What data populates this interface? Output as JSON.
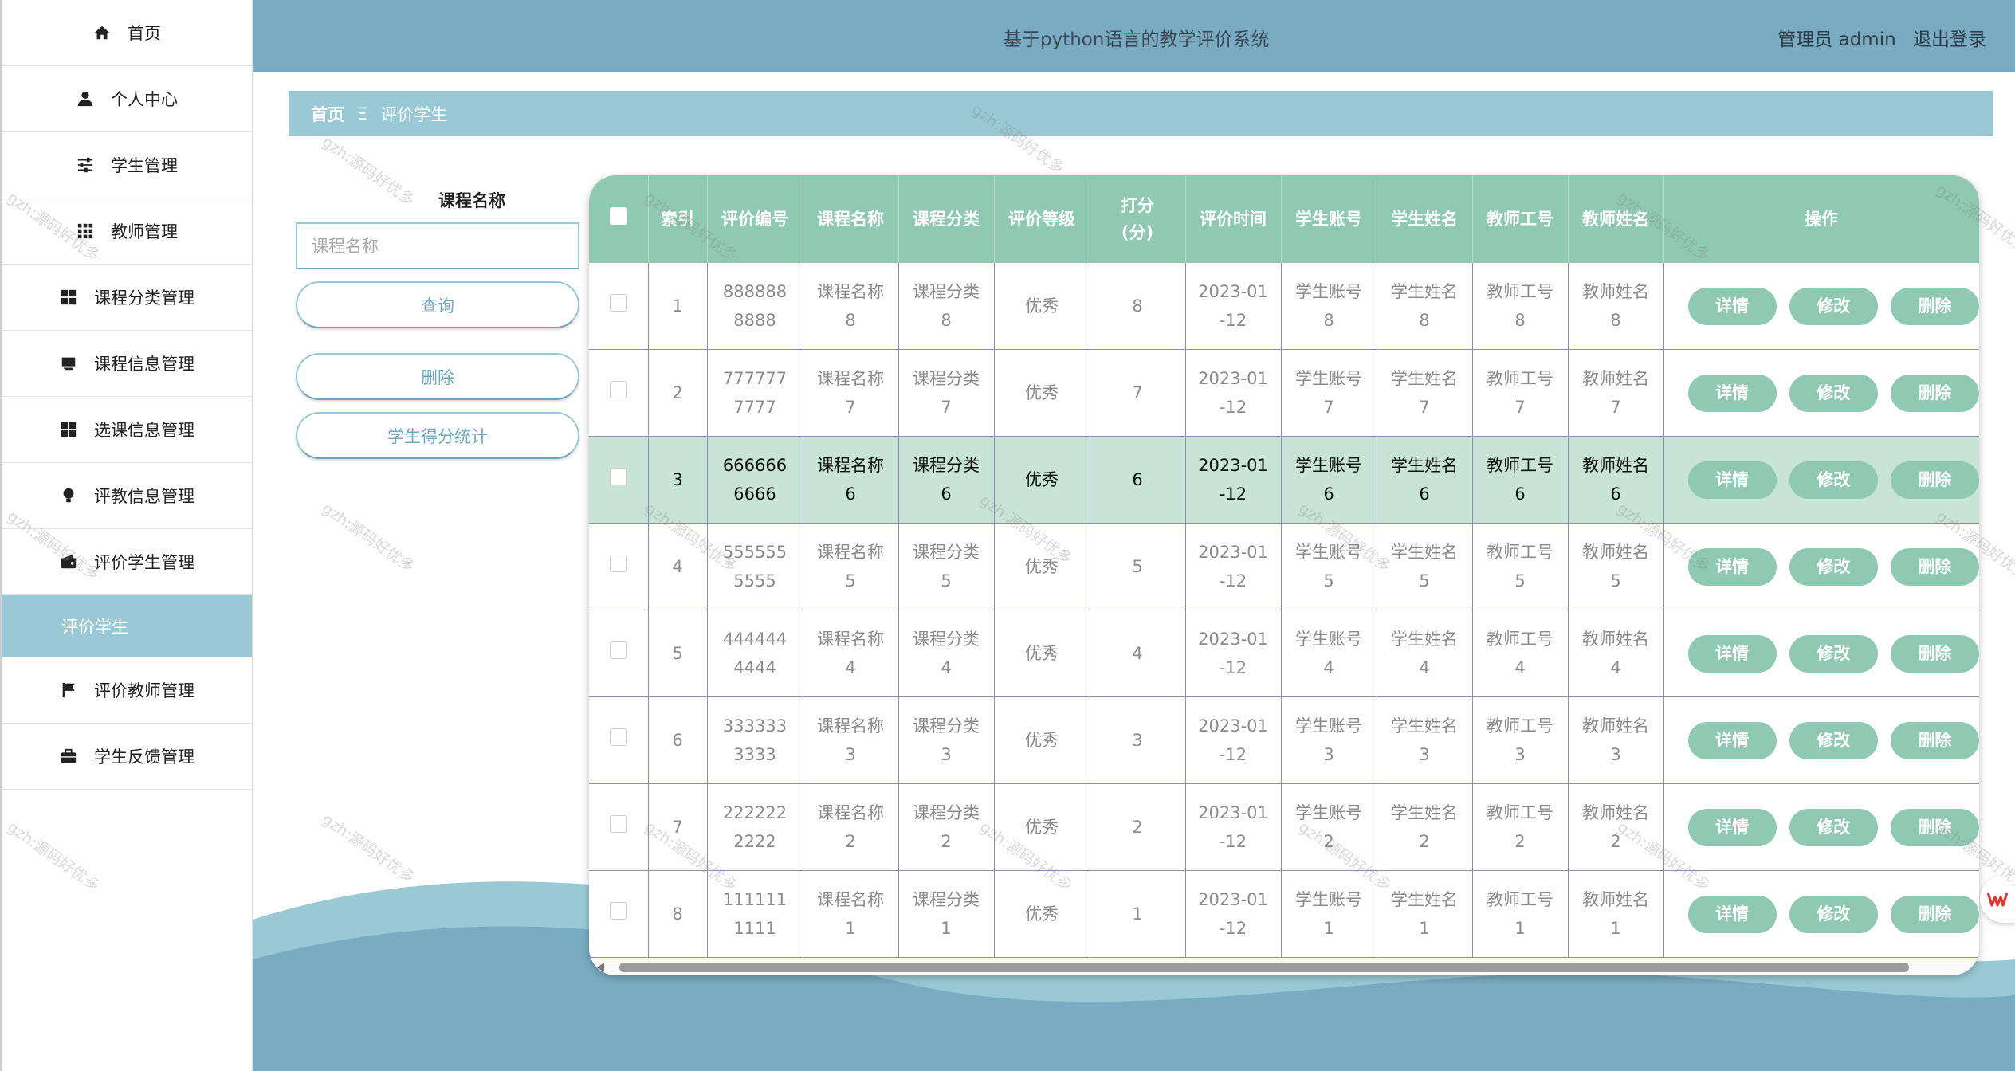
{
  "sidebar": {
    "items": [
      {
        "label": "首页",
        "icon": "home-icon"
      },
      {
        "label": "个人中心",
        "icon": "user-icon"
      },
      {
        "label": "学生管理",
        "icon": "sliders-icon"
      },
      {
        "label": "教师管理",
        "icon": "grid-icon"
      },
      {
        "label": "课程分类管理",
        "icon": "apps-icon"
      },
      {
        "label": "课程信息管理",
        "icon": "inbox-icon"
      },
      {
        "label": "选课信息管理",
        "icon": "apps-icon"
      },
      {
        "label": "评教信息管理",
        "icon": "bulb-icon"
      },
      {
        "label": "评价学生管理",
        "icon": "wallet-icon"
      },
      {
        "label": "评价学生",
        "icon": ""
      },
      {
        "label": "评价教师管理",
        "icon": "flag-icon"
      },
      {
        "label": "学生反馈管理",
        "icon": "briefcase-icon"
      }
    ]
  },
  "header": {
    "title": "基于python语言的教学评价系统",
    "user": "管理员 admin",
    "logout": "退出登录"
  },
  "breadcrumb": {
    "home": "首页",
    "separator": "Ξ",
    "current": "评价学生"
  },
  "search": {
    "label": "课程名称",
    "placeholder": "课程名称",
    "query_button": "查询",
    "delete_button": "删除",
    "stats_button": "学生得分统计"
  },
  "table": {
    "headers": [
      "索引",
      "评价编号",
      "课程名称",
      "课程分类",
      "评价等级",
      "打分(分)",
      "评价时间",
      "学生账号",
      "学生姓名",
      "教师工号",
      "教师姓名",
      "操作"
    ],
    "rows": [
      {
        "index": "1",
        "eval_no": "8888888888",
        "course": "课程名称8",
        "category": "课程分类8",
        "level": "优秀",
        "score": "8",
        "time": "2023-01-12",
        "stu_acct": "学生账号8",
        "stu_name": "学生姓名8",
        "tea_no": "教师工号8",
        "tea_name": "教师姓名8"
      },
      {
        "index": "2",
        "eval_no": "7777777777",
        "course": "课程名称7",
        "category": "课程分类7",
        "level": "优秀",
        "score": "7",
        "time": "2023-01-12",
        "stu_acct": "学生账号7",
        "stu_name": "学生姓名7",
        "tea_no": "教师工号7",
        "tea_name": "教师姓名7"
      },
      {
        "index": "3",
        "eval_no": "6666666666",
        "course": "课程名称6",
        "category": "课程分类6",
        "level": "优秀",
        "score": "6",
        "time": "2023-01-12",
        "stu_acct": "学生账号6",
        "stu_name": "学生姓名6",
        "tea_no": "教师工号6",
        "tea_name": "教师姓名6"
      },
      {
        "index": "4",
        "eval_no": "5555555555",
        "course": "课程名称5",
        "category": "课程分类5",
        "level": "优秀",
        "score": "5",
        "time": "2023-01-12",
        "stu_acct": "学生账号5",
        "stu_name": "学生姓名5",
        "tea_no": "教师工号5",
        "tea_name": "教师姓名5"
      },
      {
        "index": "5",
        "eval_no": "4444444444",
        "course": "课程名称4",
        "category": "课程分类4",
        "level": "优秀",
        "score": "4",
        "time": "2023-01-12",
        "stu_acct": "学生账号4",
        "stu_name": "学生姓名4",
        "tea_no": "教师工号4",
        "tea_name": "教师姓名4"
      },
      {
        "index": "6",
        "eval_no": "3333333333",
        "course": "课程名称3",
        "category": "课程分类3",
        "level": "优秀",
        "score": "3",
        "time": "2023-01-12",
        "stu_acct": "学生账号3",
        "stu_name": "学生姓名3",
        "tea_no": "教师工号3",
        "tea_name": "教师姓名3"
      },
      {
        "index": "7",
        "eval_no": "2222222222",
        "course": "课程名称2",
        "category": "课程分类2",
        "level": "优秀",
        "score": "2",
        "time": "2023-01-12",
        "stu_acct": "学生账号2",
        "stu_name": "学生姓名2",
        "tea_no": "教师工号2",
        "tea_name": "教师姓名2"
      },
      {
        "index": "8",
        "eval_no": "1111111111",
        "course": "课程名称1",
        "category": "课程分类1",
        "level": "优秀",
        "score": "1",
        "time": "2023-01-12",
        "stu_acct": "学生账号1",
        "stu_name": "学生姓名1",
        "tea_no": "教师工号1",
        "tea_name": "教师姓名1"
      }
    ],
    "highlighted_row": "3",
    "actions": {
      "detail": "详情",
      "edit": "修改",
      "delete": "删除"
    }
  },
  "watermark": "gzh:源码好优多",
  "colors": {
    "topbar": "#79abc2",
    "accent": "#9ac9d6",
    "table_header": "#90c9b3",
    "highlight": "#c8e4d9"
  }
}
